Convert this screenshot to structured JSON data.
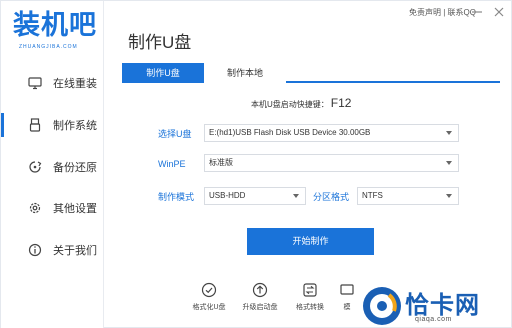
{
  "brand": {
    "logo_text": "装机吧",
    "logo_sub": "ZHUANGJIBA.COM"
  },
  "header": {
    "title": "制作U盘",
    "links": "免责声明 | 联系QQ"
  },
  "sidebar": {
    "items": [
      {
        "label": "在线重装",
        "icon": "monitor-icon"
      },
      {
        "label": "制作系统",
        "icon": "usb-drive-icon"
      },
      {
        "label": "备份还原",
        "icon": "backup-icon"
      },
      {
        "label": "其他设置",
        "icon": "gear-icon"
      },
      {
        "label": "关于我们",
        "icon": "info-icon"
      }
    ],
    "active_index": 1
  },
  "tabs": [
    {
      "label": "制作U盘",
      "active": true
    },
    {
      "label": "制作本地",
      "active": false
    }
  ],
  "hotkey": {
    "label": "本机U盘启动快捷键：",
    "key": "F12"
  },
  "form": {
    "usb": {
      "label": "选择U盘",
      "value": "E:(hd1)USB Flash Disk USB Device 30.00GB"
    },
    "winpe": {
      "label": "WinPE",
      "value": "标准版"
    },
    "mode": {
      "label": "制作模式",
      "value": "USB-HDD"
    },
    "partition": {
      "label": "分区格式",
      "value": "NTFS"
    }
  },
  "start_button": "开始制作",
  "tools": [
    {
      "label": "格式化U盘",
      "icon": "check-circle-icon"
    },
    {
      "label": "升级启动盘",
      "icon": "upgrade-icon"
    },
    {
      "label": "格式转换",
      "icon": "convert-icon"
    },
    {
      "label": "模",
      "icon": "simulate-icon"
    }
  ],
  "watermark": {
    "text": "恰卡网",
    "url": "qiaqa.com"
  },
  "colors": {
    "accent": "#1a73d9",
    "watermark": "#1a5fb4"
  }
}
